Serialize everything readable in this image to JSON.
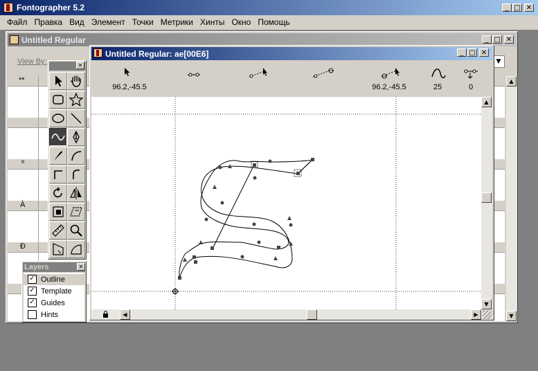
{
  "app_title": "Fontographer 5.2",
  "menu": [
    "Файл",
    "Правка",
    "Вид",
    "Элемент",
    "Точки",
    "Метрики",
    "Хинты",
    "Окно",
    "Помощь"
  ],
  "font_window": {
    "title": "Untitled Regular",
    "view_by_label": "View By:",
    "rows": [
      "**",
      "º",
      "À",
      "Ð"
    ]
  },
  "glyph_window": {
    "title": "Untitled Regular: ae[00E6]",
    "toolbar": {
      "pointer_coords": "96.2,-45.5",
      "point_coords": "96.2,-45.5",
      "curve_value": "25",
      "hint_value": "0"
    }
  },
  "layers": {
    "title": "Layers",
    "items": [
      {
        "label": "Outline",
        "checked": true
      },
      {
        "label": "Template",
        "checked": true
      },
      {
        "label": "Guides",
        "checked": true
      },
      {
        "label": "Hints",
        "checked": false
      }
    ]
  },
  "colors": {
    "titlebar_active": "#0a246a",
    "face": "#d4d0c8",
    "desktop": "#808080"
  }
}
